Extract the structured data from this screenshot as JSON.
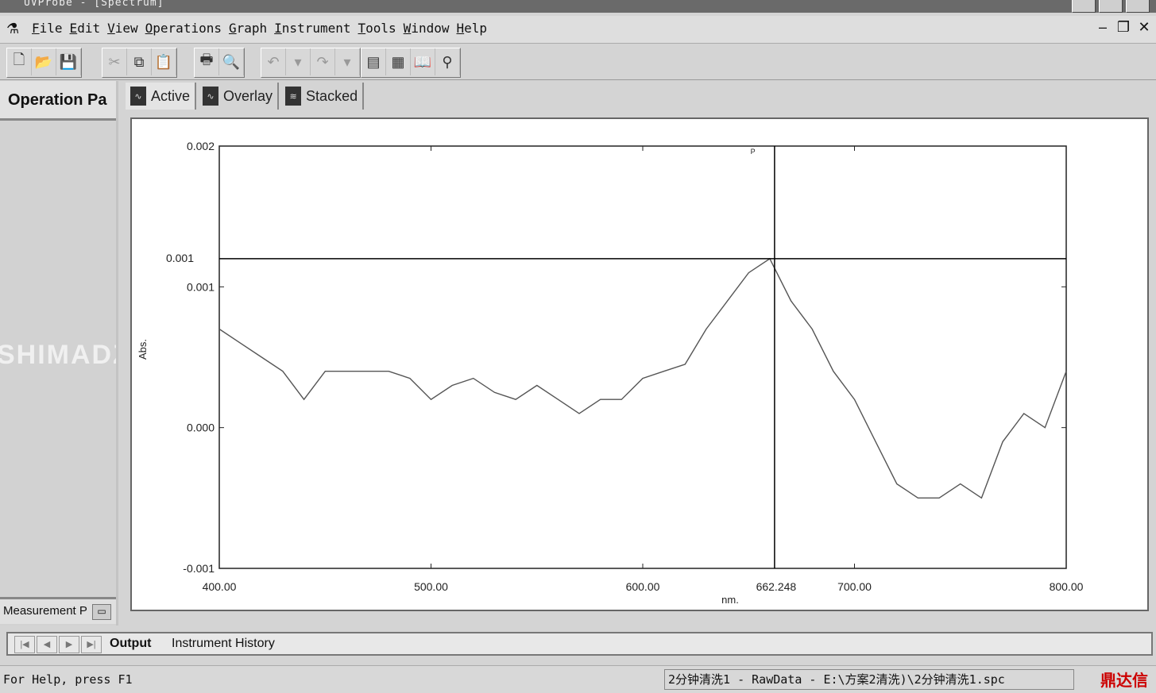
{
  "window": {
    "title": "UVProbe - [Spectrum]"
  },
  "menu": {
    "items": [
      "File",
      "Edit",
      "View",
      "Operations",
      "Graph",
      "Instrument",
      "Tools",
      "Window",
      "Help"
    ]
  },
  "left_panel": {
    "title": "Operation Pa",
    "watermark": "SHIMADZU",
    "bottom_label": "Measurement P"
  },
  "tabs": [
    {
      "label": "Active"
    },
    {
      "label": "Overlay"
    },
    {
      "label": "Stacked"
    }
  ],
  "chart_data": {
    "type": "line",
    "title": "",
    "xlabel": "nm.",
    "ylabel": "Abs.",
    "xlim": [
      400,
      800
    ],
    "ylim": [
      -0.001,
      0.002
    ],
    "x_ticks": [
      "400.00",
      "500.00",
      "600.00",
      "700.00",
      "800.00"
    ],
    "y_ticks": [
      "-0.001",
      "0.000",
      "0.001",
      "0.002"
    ],
    "cursor": {
      "x": 662.248,
      "x_label": "662.248",
      "y": 0.0012,
      "y_label": "0.001"
    },
    "peak_marker": "P",
    "series": [
      {
        "x": [
          400,
          410,
          420,
          430,
          440,
          450,
          460,
          470,
          480,
          490,
          500,
          510,
          520,
          530,
          540,
          550,
          560,
          570,
          580,
          590,
          600,
          610,
          620,
          630,
          640,
          650,
          660,
          670,
          680,
          690,
          700,
          710,
          720,
          730,
          740,
          750,
          760,
          770,
          780,
          790,
          800
        ],
        "y": [
          0.0007,
          0.0006,
          0.0005,
          0.0004,
          0.0002,
          0.0004,
          0.0004,
          0.0004,
          0.0004,
          0.00035,
          0.0002,
          0.0003,
          0.00035,
          0.00025,
          0.0002,
          0.0003,
          0.0002,
          0.0001,
          0.0002,
          0.0002,
          0.00035,
          0.0004,
          0.00045,
          0.0007,
          0.0009,
          0.0011,
          0.0012,
          0.0009,
          0.0007,
          0.0004,
          0.0002,
          -0.0001,
          -0.0004,
          -0.0005,
          -0.0005,
          -0.0004,
          -0.0005,
          -0.0001,
          0.0001,
          0.0,
          0.0004
        ]
      }
    ]
  },
  "output": {
    "tabs": [
      "Output",
      "Instrument History"
    ]
  },
  "status": {
    "help": "For Help, press F1",
    "file": "2分钟清洗1 - RawData - E:\\方案2清洗)\\2分钟清洗1.spc",
    "logo": "鼎达信"
  }
}
